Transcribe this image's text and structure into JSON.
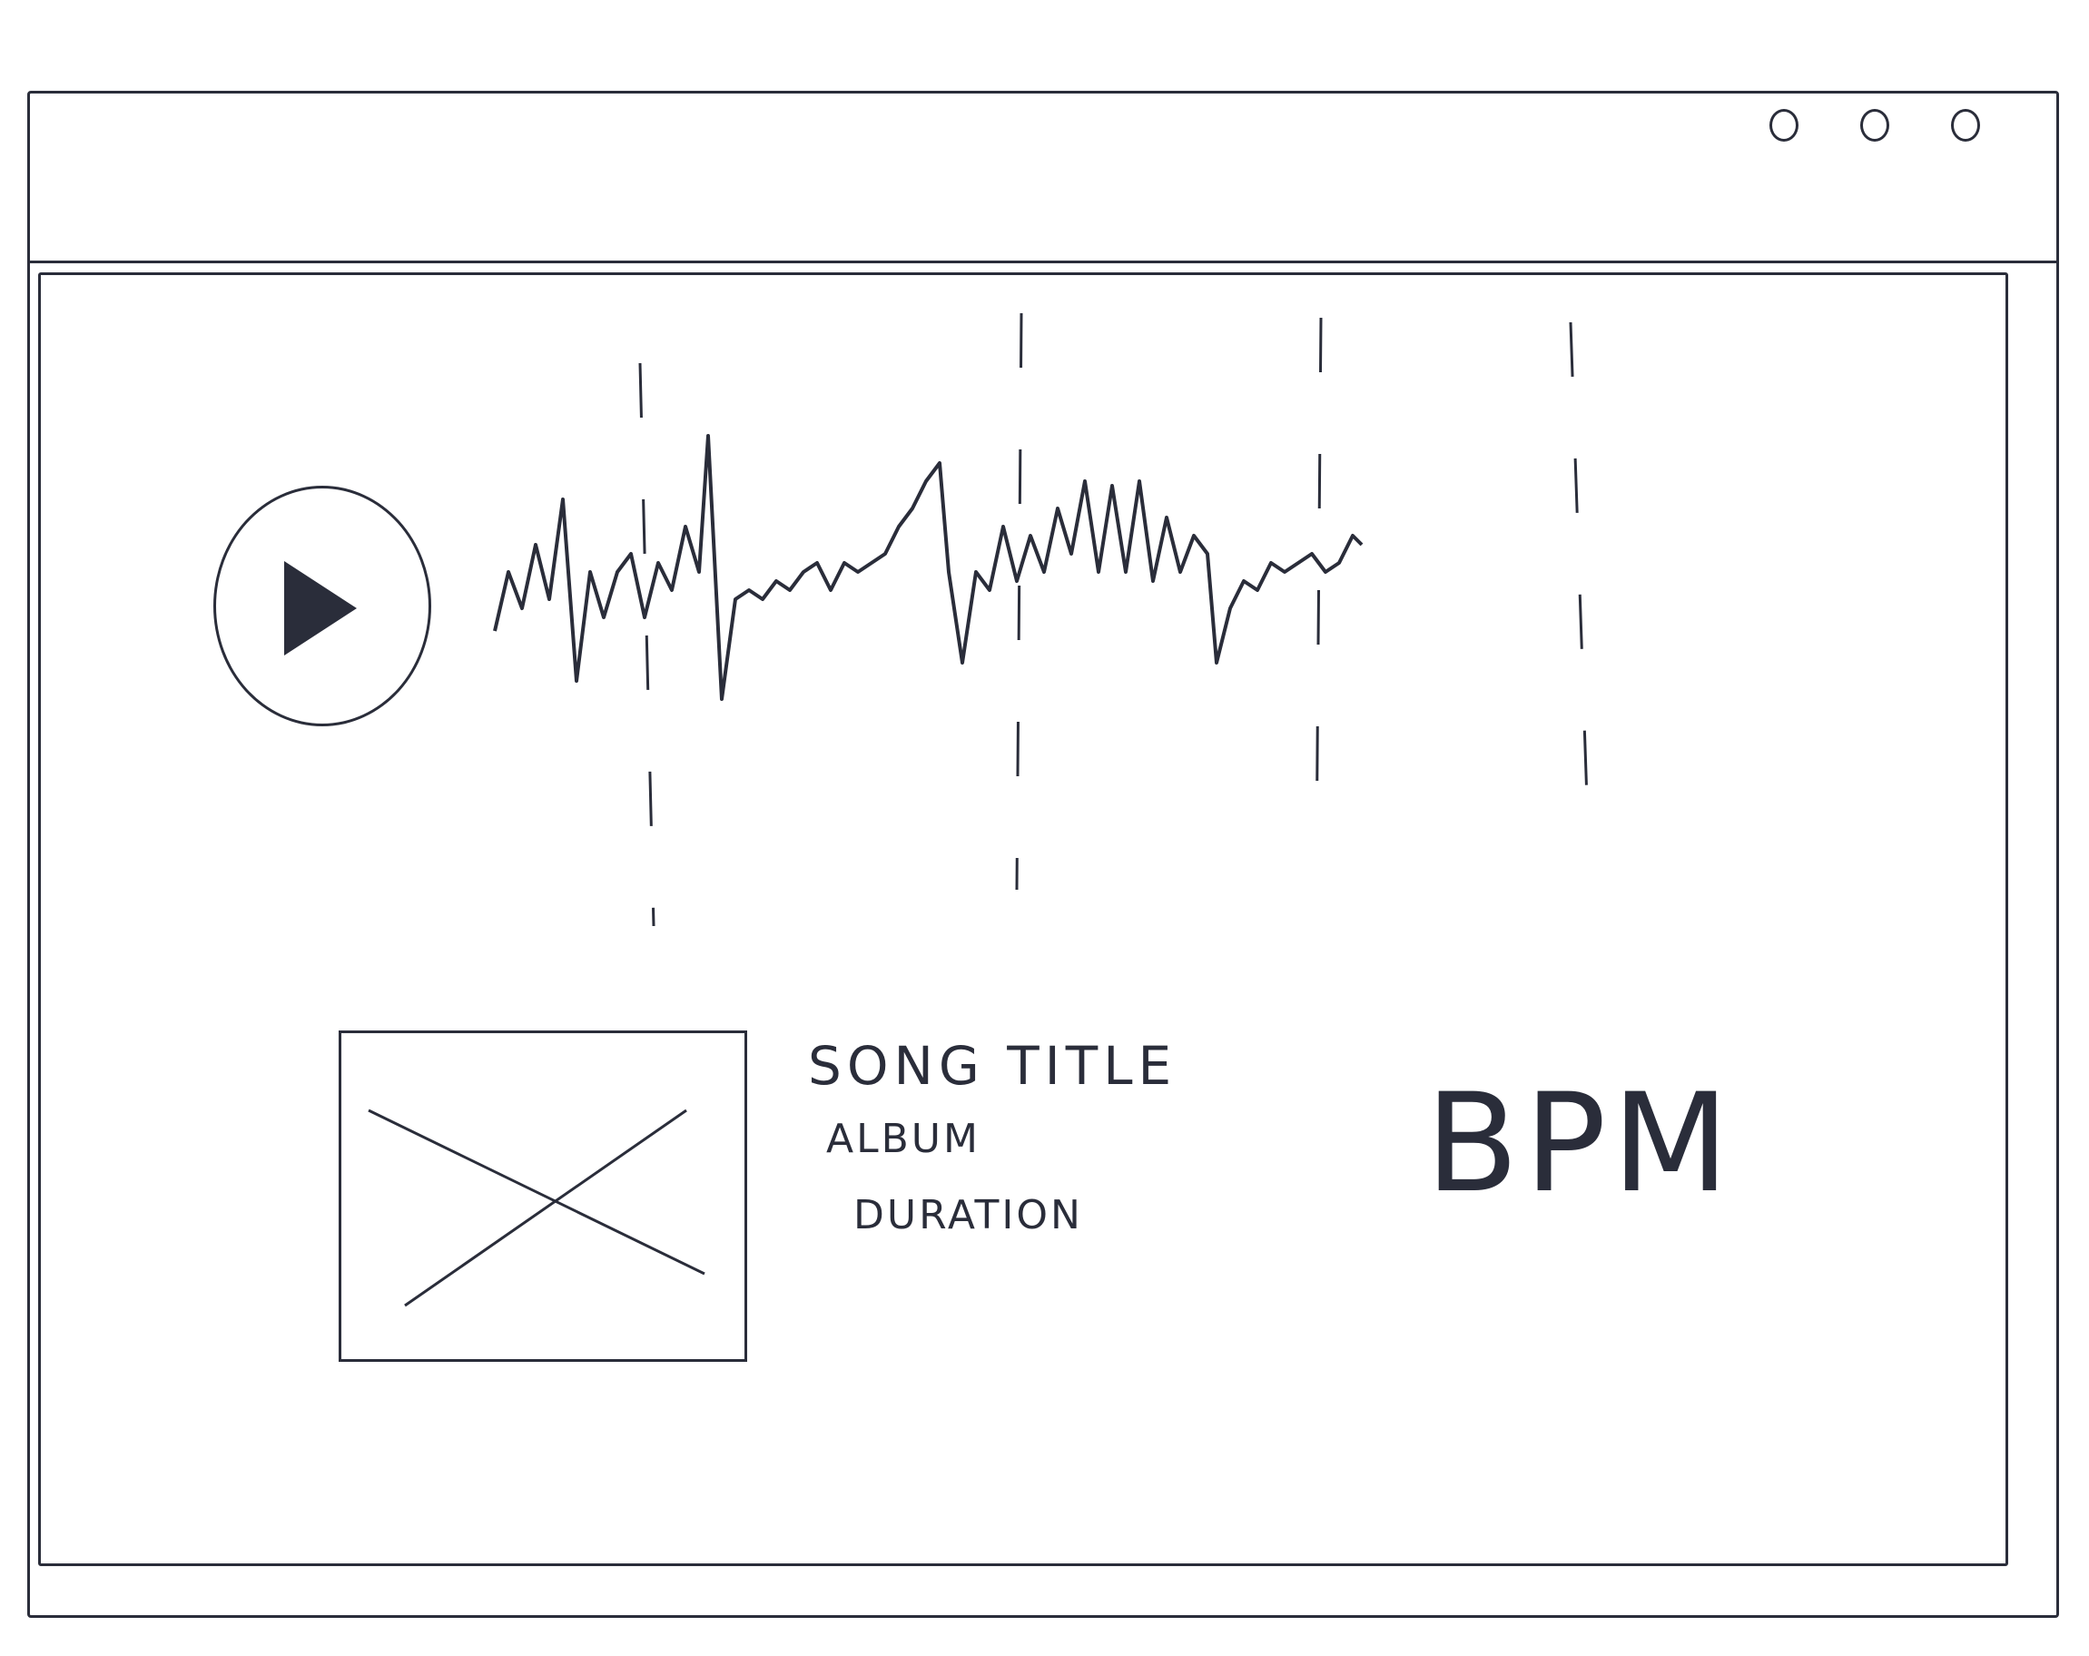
{
  "window": {
    "controls": [
      "minimize",
      "maximize",
      "close"
    ]
  },
  "player": {
    "play_icon": "play-icon"
  },
  "track": {
    "title": "SONG TITLE",
    "album": "ALBUM",
    "duration": "DURATION",
    "bpm": "BPM"
  },
  "album_art": {
    "icon": "image-placeholder-icon"
  },
  "colors": {
    "ink": "#2a2d3a",
    "paper": "#ffffff"
  }
}
